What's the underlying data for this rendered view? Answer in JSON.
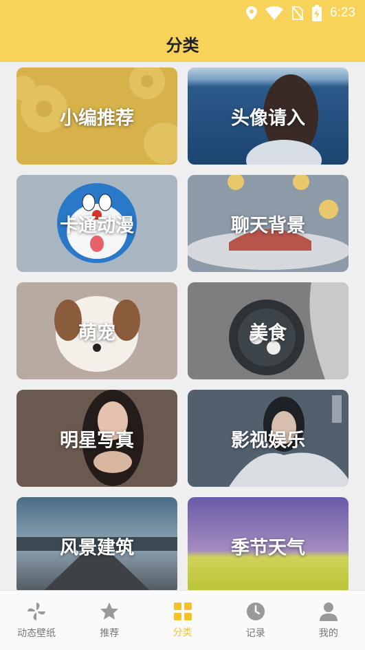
{
  "status": {
    "time": "6:23"
  },
  "header": {
    "title": "分类"
  },
  "categories": [
    {
      "label": "小编推荐"
    },
    {
      "label": "头像请入"
    },
    {
      "label": "卡通动漫"
    },
    {
      "label": "聊天背景"
    },
    {
      "label": "萌宠"
    },
    {
      "label": "美食"
    },
    {
      "label": "明星写真"
    },
    {
      "label": "影视娱乐"
    },
    {
      "label": "风景建筑"
    },
    {
      "label": "季节天气"
    }
  ],
  "tabs": [
    {
      "label": "动态壁纸",
      "icon": "pinwheel-icon"
    },
    {
      "label": "推荐",
      "icon": "star-icon"
    },
    {
      "label": "分类",
      "icon": "grid-icon",
      "active": true
    },
    {
      "label": "记录",
      "icon": "clock-icon"
    },
    {
      "label": "我的",
      "icon": "user-icon"
    }
  ],
  "colors": {
    "header": "#f7d35a",
    "active_tab": "#f3c22a"
  }
}
